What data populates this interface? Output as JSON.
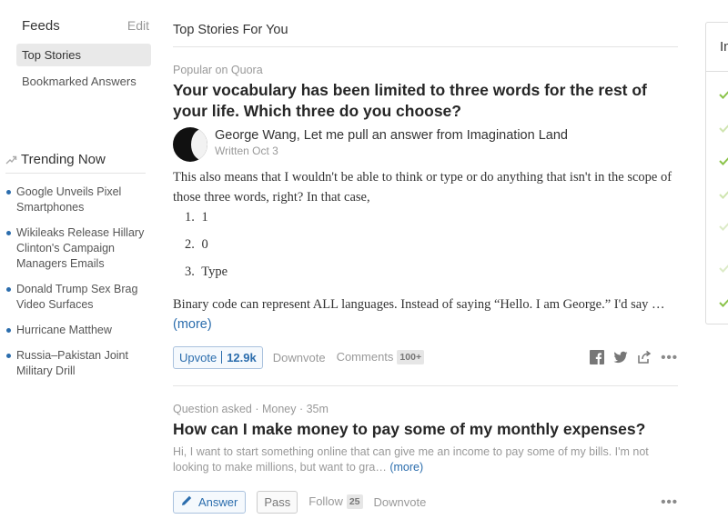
{
  "sidebar": {
    "feeds_title": "Feeds",
    "edit_label": "Edit",
    "items": [
      {
        "label": "Top Stories",
        "active": true
      },
      {
        "label": "Bookmarked Answers",
        "active": false
      }
    ]
  },
  "trending": {
    "title": "Trending Now",
    "items": [
      "Google Unveils Pixel Smartphones",
      "Wikileaks Release Hillary Clinton's Campaign Managers Emails",
      "Donald Trump Sex Brag Video Surfaces",
      "Hurricane Matthew",
      "Russia–Pakistan Joint Military Drill"
    ]
  },
  "main": {
    "title": "Top Stories For You",
    "story1": {
      "meta": "Popular on Quora",
      "question": "Your vocabulary has been limited to three words for the rest of your life. Which three do you choose?",
      "author": "George Wang, Let me pull an answer from Imagination Land",
      "written": "Written Oct 3",
      "intro": "This also means that I wouldn't be able to think or type or do anything that isn't in the scope of those three words, right? In that case,",
      "list": [
        {
          "num": "1.",
          "text": "1"
        },
        {
          "num": "2.",
          "text": "0"
        },
        {
          "num": "3.",
          "text": "Type"
        }
      ],
      "tail": "Binary code can represent ALL languages. Instead of saying “Hello. I am George.” I'd say …",
      "more": "(more)",
      "upvote_label": "Upvote",
      "upvote_count": "12.9k",
      "downvote_label": "Downvote",
      "comments_label": "Comments",
      "comments_count": "100+"
    },
    "story2": {
      "meta": "Question asked · Money · 35m",
      "question": "How can I make money to pay some of my monthly expenses?",
      "detail": "Hi, I want to start something online that can give me an income to pay some of my bills. I'm not looking to make millions, but want to gra…",
      "more": "(more)",
      "answer_label": "Answer",
      "pass_label": "Pass",
      "follow_label": "Follow",
      "follow_count": "25",
      "downvote_label": "Downvote"
    }
  },
  "right_panel": {
    "title": "Im"
  },
  "colors": {
    "link": "#2b6dad",
    "check": "#8bc34a"
  }
}
